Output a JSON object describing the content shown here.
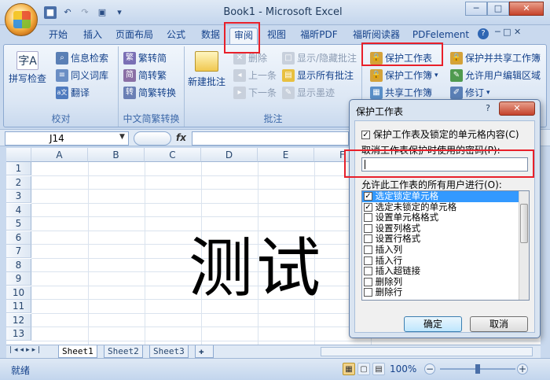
{
  "window": {
    "title": "Book1 - Microsoft Excel"
  },
  "tabs": [
    "开始",
    "插入",
    "页面布局",
    "公式",
    "数据",
    "审阅",
    "视图",
    "福昕PDF",
    "福昕阅读器",
    "PDFelement"
  ],
  "active_tab": "审阅",
  "ribbon": {
    "proofing": {
      "label": "校对",
      "spell": "拼写检查",
      "research": "信息检索",
      "thesaurus": "同义词库",
      "translate": "翻译"
    },
    "chinese": {
      "label": "中文简繁转换",
      "trad": "繁转简",
      "simp": "简转繁",
      "convert": "简繁转换"
    },
    "comments": {
      "label": "批注",
      "new": "新建批注",
      "delete": "删除",
      "prev": "上一条",
      "next": "下一条",
      "toggle": "显示/隐藏批注",
      "showall": "显示所有批注",
      "ink": "显示墨迹"
    },
    "changes": {
      "protect_sheet": "保护工作表",
      "protect_wb": "保护工作簿",
      "share_wb": "共享工作簿",
      "protect_share": "保护并共享工作簿",
      "allow_edit": "允许用户编辑区域",
      "track": "修订"
    }
  },
  "formula": {
    "namebox": "J14",
    "fx": "fx"
  },
  "columns": [
    "A",
    "B",
    "C",
    "D",
    "E",
    "F"
  ],
  "rows": [
    "1",
    "2",
    "3",
    "4",
    "5",
    "6",
    "7",
    "8",
    "9",
    "10",
    "11",
    "12",
    "13"
  ],
  "cell_text": "测试",
  "sheets": [
    "Sheet1",
    "Sheet2",
    "Sheet3"
  ],
  "status": {
    "ready": "就绪",
    "zoom": "100%"
  },
  "dialog": {
    "title": "保护工作表",
    "protect_check": "保护工作表及锁定的单元格内容(C)",
    "pwd_label": "取消工作表保护时使用的密码(P):",
    "allow_label": "允许此工作表的所有用户进行(O):",
    "options": [
      {
        "label": "选定锁定单元格",
        "checked": true
      },
      {
        "label": "选定未锁定的单元格",
        "checked": true
      },
      {
        "label": "设置单元格格式",
        "checked": false
      },
      {
        "label": "设置列格式",
        "checked": false
      },
      {
        "label": "设置行格式",
        "checked": false
      },
      {
        "label": "插入列",
        "checked": false
      },
      {
        "label": "插入行",
        "checked": false
      },
      {
        "label": "插入超链接",
        "checked": false
      },
      {
        "label": "删除列",
        "checked": false
      },
      {
        "label": "删除行",
        "checked": false
      }
    ],
    "ok": "确定",
    "cancel": "取消"
  }
}
